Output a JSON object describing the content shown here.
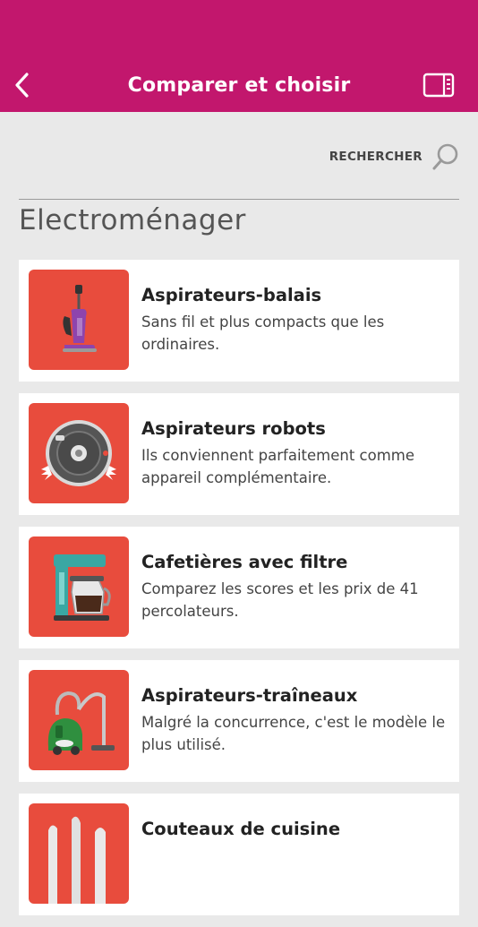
{
  "header": {
    "title": "Comparer et choisir",
    "back_icon": "chevron-left-icon",
    "panel_icon": "sidebar-panel-icon",
    "color": "#c2176d"
  },
  "search": {
    "label": "RECHERCHER",
    "icon": "search-icon"
  },
  "section": {
    "title": "Electroménager"
  },
  "categories": [
    {
      "title": "Aspirateurs-balais",
      "description": "Sans fil et plus compacts que les ordinaires.",
      "icon": "stick-vacuum-icon"
    },
    {
      "title": "Aspirateurs robots",
      "description": "Ils conviennent parfaitement comme appareil complémentaire.",
      "icon": "robot-vacuum-icon"
    },
    {
      "title": "Cafetières avec filtre",
      "description": "Comparez les scores et les prix de 41 percolateurs.",
      "icon": "coffee-maker-icon"
    },
    {
      "title": "Aspirateurs-traîneaux",
      "description": "Malgré la concurrence, c'est le modèle le plus utilisé.",
      "icon": "canister-vacuum-icon"
    },
    {
      "title": "Couteaux de cuisine",
      "description": "",
      "icon": "kitchen-knives-icon"
    }
  ],
  "colors": {
    "thumb_bg": "#e84c3d",
    "background": "#e9e9e9"
  }
}
